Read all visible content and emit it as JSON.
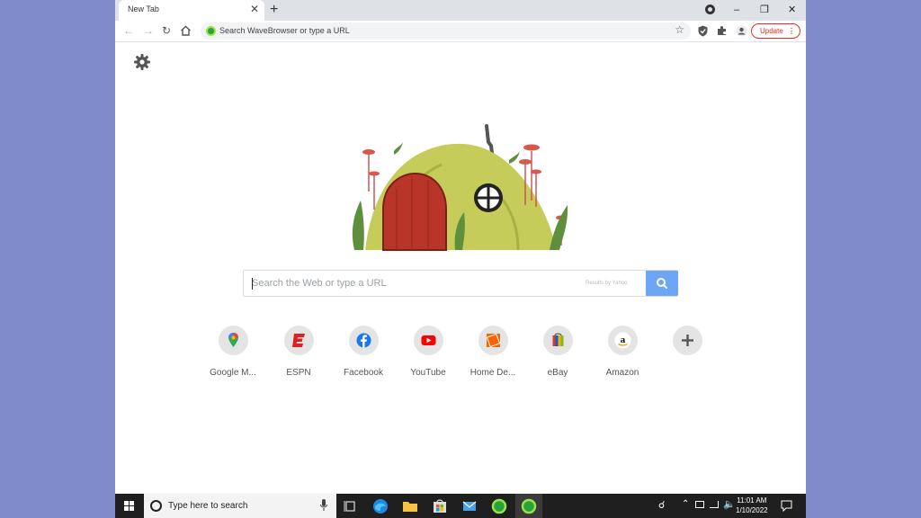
{
  "browser": {
    "tab_title": "New Tab",
    "tab_close": "✕",
    "new_tab": "+",
    "window_controls": {
      "minimize": "–",
      "restore": "❐",
      "close": "✕"
    },
    "omnibox_text": "Search WaveBrowser or type a URL",
    "update_label": "Update",
    "update_menu": "⋮"
  },
  "page": {
    "search_placeholder": "Search the Web or type a URL",
    "results_by": "Results by Yahoo",
    "tiles": [
      {
        "label": "Google M...",
        "icon": "google-maps-icon"
      },
      {
        "label": "ESPN",
        "icon": "espn-icon"
      },
      {
        "label": "Facebook",
        "icon": "facebook-icon"
      },
      {
        "label": "YouTube",
        "icon": "youtube-icon"
      },
      {
        "label": "Home De...",
        "icon": "home-depot-icon"
      },
      {
        "label": "eBay",
        "icon": "ebay-icon"
      },
      {
        "label": "Amazon",
        "icon": "amazon-icon"
      }
    ]
  },
  "taskbar": {
    "search_text": "Type here to search",
    "time": "11:01 AM",
    "date": "1/10/2022"
  },
  "colors": {
    "desktop": "#7f8bcb",
    "accent_blue": "#6ea6f6",
    "update_red": "#d93025",
    "brand_green": "#27a33c"
  }
}
